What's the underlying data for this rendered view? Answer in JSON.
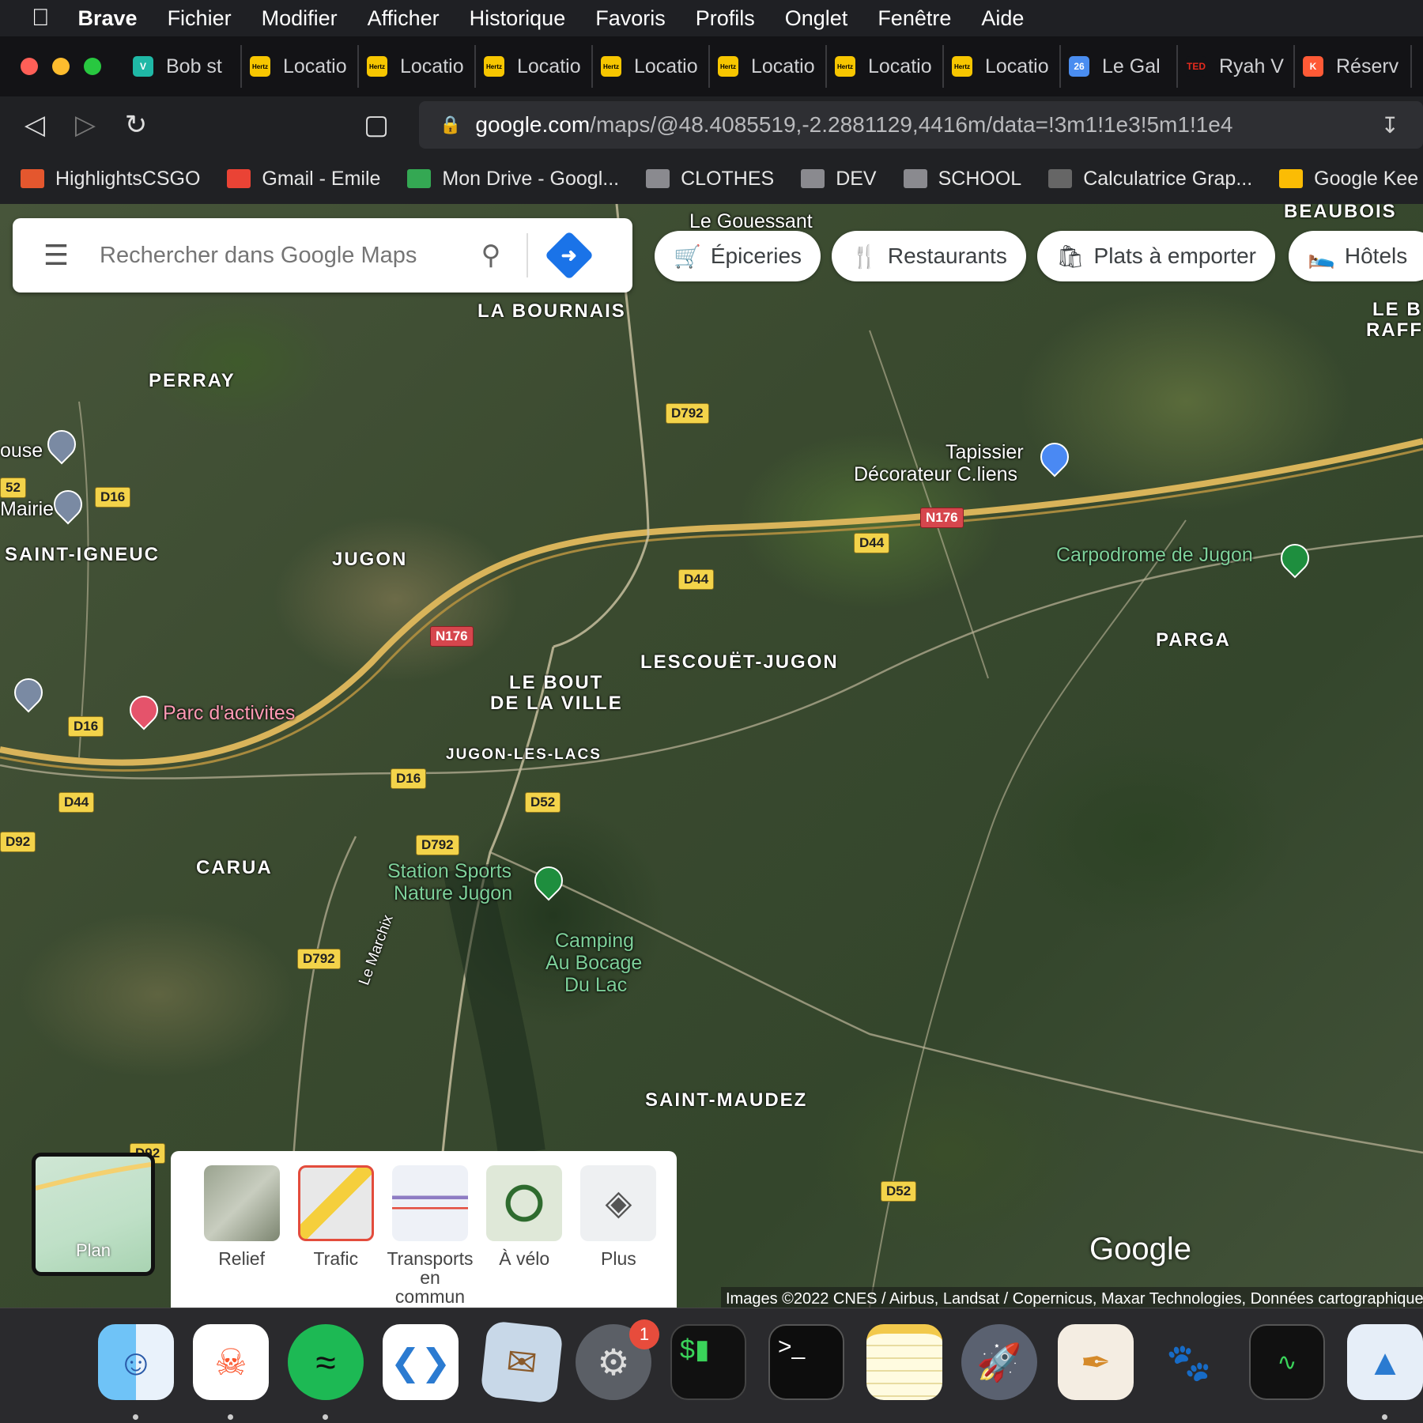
{
  "menubar": {
    "apple": "",
    "app": "Brave",
    "items": [
      "Fichier",
      "Modifier",
      "Afficher",
      "Historique",
      "Favoris",
      "Profils",
      "Onglet",
      "Fenêtre",
      "Aide"
    ]
  },
  "tabs": [
    {
      "label": "Bob st",
      "fav": "V",
      "color": "#1fb8a6"
    },
    {
      "label": "Locatio",
      "fav": "Hertz",
      "color": "#f7c600"
    },
    {
      "label": "Locatio",
      "fav": "Hertz",
      "color": "#f7c600"
    },
    {
      "label": "Locatio",
      "fav": "Hertz",
      "color": "#f7c600"
    },
    {
      "label": "Locatio",
      "fav": "Hertz",
      "color": "#f7c600"
    },
    {
      "label": "Locatio",
      "fav": "Hertz",
      "color": "#f7c600"
    },
    {
      "label": "Locatio",
      "fav": "Hertz",
      "color": "#f7c600"
    },
    {
      "label": "Locatio",
      "fav": "Hertz",
      "color": "#f7c600"
    },
    {
      "label": "Le Gal",
      "fav": "26",
      "color": "#4a8df0"
    },
    {
      "label": "Ryah V",
      "fav": "TED",
      "color": "#131316"
    },
    {
      "label": "Réserv",
      "fav": "K",
      "color": "#ff5a36"
    }
  ],
  "url": {
    "host": "google.com",
    "path": "/maps/@48.4085519,-2.2881129,4416m/data=!3m1!1e3!5m1!1e4"
  },
  "bookmarks": [
    {
      "label": "HighlightsCSGO",
      "icon": "flame-icon",
      "color": "#e4572e"
    },
    {
      "label": "Gmail - Emile",
      "icon": "gmail-icon",
      "color": "#ea4335"
    },
    {
      "label": "Mon Drive - Googl...",
      "icon": "drive-icon",
      "color": "#34a853"
    },
    {
      "label": "CLOTHES",
      "icon": "folder-icon",
      "color": "#8a8a8f"
    },
    {
      "label": "DEV",
      "icon": "folder-icon",
      "color": "#8a8a8f"
    },
    {
      "label": "SCHOOL",
      "icon": "folder-icon",
      "color": "#8a8a8f"
    },
    {
      "label": "Calculatrice Grap...",
      "icon": "graph-icon",
      "color": "#666"
    },
    {
      "label": "Google Kee",
      "icon": "keep-icon",
      "color": "#fbbc04"
    }
  ],
  "search": {
    "placeholder": "Rechercher dans Google Maps"
  },
  "chips": [
    "Épiceries",
    "Restaurants",
    "Plats à emporter",
    "Hôtels"
  ],
  "places": [
    "LA BOURNAIS",
    "PERRAY",
    "SAINT-IGNEUC",
    "JUGON",
    "LESCOUËT-JUGON",
    "LE BOUT",
    "DE LA VILLE",
    "JUGON-LES-LACS",
    "CARUA",
    "PARGA",
    "SAINT-MAUDEZ",
    "BEAUBOIS",
    "LE B",
    "RAFF"
  ],
  "pois": {
    "gouessant": "Le Gouessant",
    "tapissier1": "Tapissier",
    "tapissier2": "Décorateur C.liens",
    "carpodrome": "Carpodrome de Jugon",
    "parc": "Parc d'activites",
    "station1": "Station Sports",
    "station2": "Nature Jugon",
    "camping1": "Camping",
    "camping2": "Au Bocage",
    "camping3": "Du Lac",
    "mairie": "Mairie",
    "ouse": "ouse",
    "lemarchix": "Le Marchix"
  },
  "roads": [
    "D792",
    "N176",
    "D44",
    "D44",
    "D16",
    "N176",
    "D16",
    "D16",
    "D44",
    "D52",
    "D792",
    "D92",
    "D792",
    "D52",
    "52",
    "D92"
  ],
  "layers": {
    "current": "Plan",
    "items": [
      "Relief",
      "Trafic",
      "Transports en commun",
      "À vélo",
      "Plus"
    ]
  },
  "logo": "Google",
  "attribution": "Images ©2022 CNES / Airbus, Landsat / Copernicus, Maxar Technologies, Données cartographiques",
  "dock": {
    "badge": "1"
  }
}
